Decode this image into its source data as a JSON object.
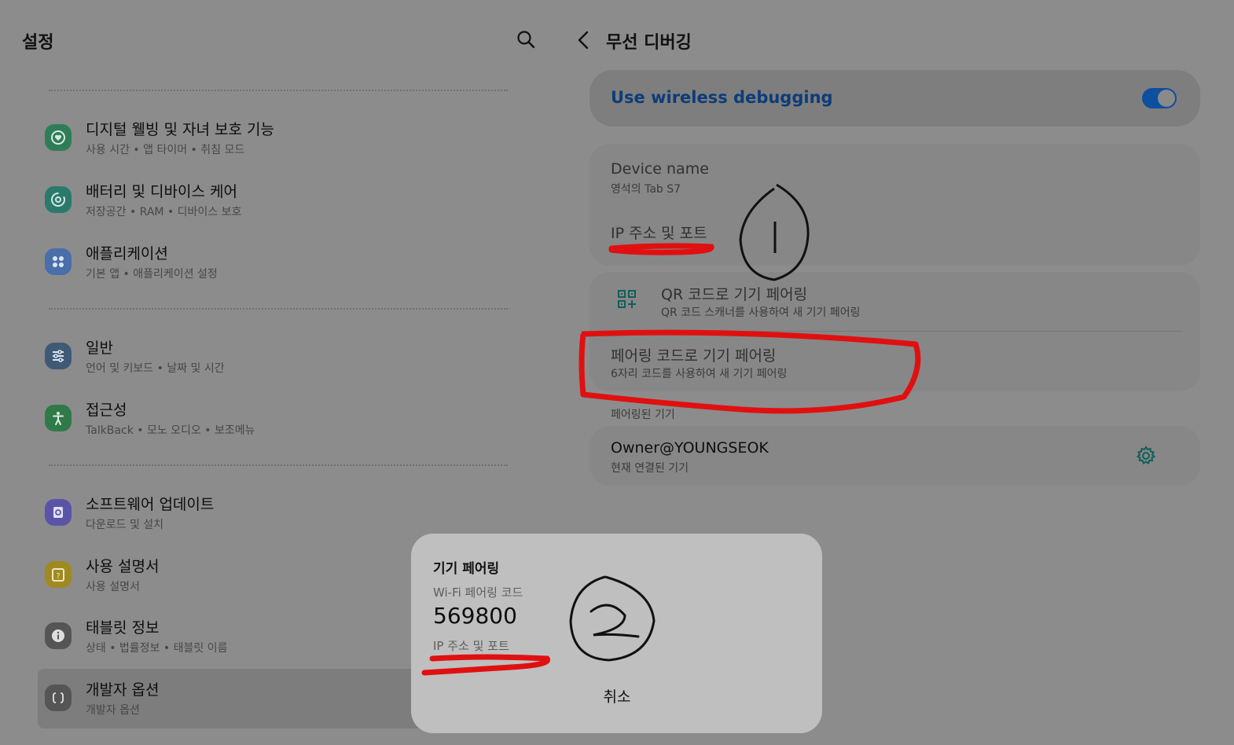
{
  "settings": {
    "title": "설정",
    "groups": [
      [
        {
          "title": "디지털 웰빙 및 자녀 보호 기능",
          "subtitle": "사용 시간 • 앱 타이머 • 취침 모드",
          "icon": "wellbeing-icon",
          "color": "#2f7d58"
        },
        {
          "title": "배터리 및 디바이스 케어",
          "subtitle": "저장공간 • RAM • 디바이스 보호",
          "icon": "device-care-icon",
          "color": "#2a7a6c"
        }
      ],
      [
        {
          "title": "애플리케이션",
          "subtitle": "기본 앱 • 애플리케이션 설정",
          "icon": "apps-icon",
          "color": "#4a6eaa"
        }
      ],
      [
        {
          "title": "일반",
          "subtitle": "언어 및 키보드 • 날짜 및 시간",
          "icon": "general-icon",
          "color": "#3f5a77"
        },
        {
          "title": "접근성",
          "subtitle": "TalkBack • 모노 오디오 • 보조메뉴",
          "icon": "accessibility-icon",
          "color": "#2f7a48"
        }
      ],
      [
        {
          "title": "소프트웨어 업데이트",
          "subtitle": "다운로드 및 설치",
          "icon": "software-update-icon",
          "color": "#5a54a8"
        },
        {
          "title": "사용 설명서",
          "subtitle": "사용 설명서",
          "icon": "user-manual-icon",
          "color": "#a08a20"
        },
        {
          "title": "태블릿 정보",
          "subtitle": "상태 • 법률정보 • 태블릿 이름",
          "icon": "info-icon",
          "color": "#555555"
        },
        {
          "title": "개발자 옵션",
          "subtitle": "개발자 옵션",
          "icon": "developer-icon",
          "color": "#555555",
          "selected": true
        }
      ]
    ]
  },
  "wireless": {
    "title": "무선 디버깅",
    "toggle_label": "Use wireless debugging",
    "toggle_on": true,
    "device_name_label": "Device name",
    "device_name_value": "영석의 Tab S7",
    "ip_label": "IP 주소 및 포트",
    "qr_title": "QR 코드로 기기 페어링",
    "qr_subtitle": "QR 코드 스캐너를 사용하여 새 기기 페어링",
    "pair_code_title": "페어링 코드로 기기 페어링",
    "pair_code_subtitle": "6자리 코드를 사용하여 새 기기 페어링",
    "paired_header": "페어링된 기기",
    "paired_device_name": "Owner@YOUNGSEOK",
    "paired_device_status": "현재 연결된 기기"
  },
  "dialog": {
    "title": "기기 페어링",
    "code_label": "Wi-Fi 페어링 코드",
    "code": "569800",
    "ip_label": "IP 주소 및 포트",
    "cancel_label": "취소"
  },
  "colors": {
    "accent": "#0e4fa0",
    "annotation": "#e01010",
    "gear": "#0f5f5a"
  }
}
